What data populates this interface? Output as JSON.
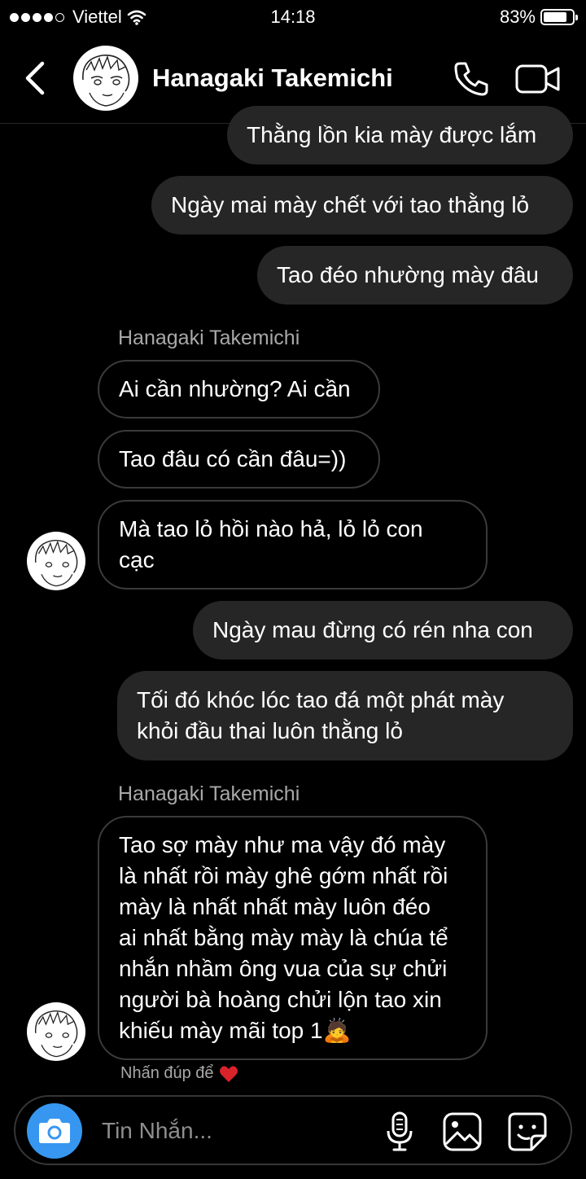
{
  "status_bar": {
    "carrier": "Viettel",
    "time": "14:18",
    "battery_percent": "83%",
    "battery_level": 0.83,
    "signal_bars_filled": 4,
    "signal_bars_total": 5
  },
  "header": {
    "contact_name": "Hanagaki Takemichi"
  },
  "messages": [
    {
      "side": "out",
      "text": "Thằng lồn kia mày được lắm"
    },
    {
      "side": "out",
      "text": "Ngày mai mày chết với tao thằng lỏ"
    },
    {
      "side": "out",
      "text": "Tao đéo nhường mày đâu"
    },
    {
      "side": "in",
      "sender": "Hanagaki Takemichi",
      "text": "Ai cần nhường? Ai cần"
    },
    {
      "side": "in",
      "text": "Tao đâu có cần đâu=))"
    },
    {
      "side": "in",
      "text": "Mà tao lỏ hồi nào hả, lỏ lỏ con\ncạc"
    },
    {
      "side": "out",
      "text": "Ngày mau đừng có rén nha con"
    },
    {
      "side": "out",
      "text": "Tối đó khóc lóc tao đá một phát mày\nkhỏi đầu thai luôn thằng lỏ"
    },
    {
      "side": "in",
      "sender": "Hanagaki Takemichi",
      "text": "Tao sợ mày như ma vậy đó mày\nlà nhất rồi mày ghê gớm nhất rồi\nmày là nhất nhất mày luôn đéo\nai nhất bằng mày mày là chúa tể\nnhắn nhầm ông vua của sự chửi\nngười bà hoàng chửi lộn tao xin\nkhiếu mày mãi top 1🙇"
    }
  ],
  "reaction_hint": "Nhấn đúp để",
  "composer": {
    "placeholder": "Tin Nhắn..."
  },
  "colors": {
    "background": "#000000",
    "outgoing_bubble": "#262626",
    "incoming_border": "#3a3a3a",
    "camera_button": "#3797f0",
    "secondary_text": "#a8a8a8",
    "heart": "#d8232a"
  }
}
